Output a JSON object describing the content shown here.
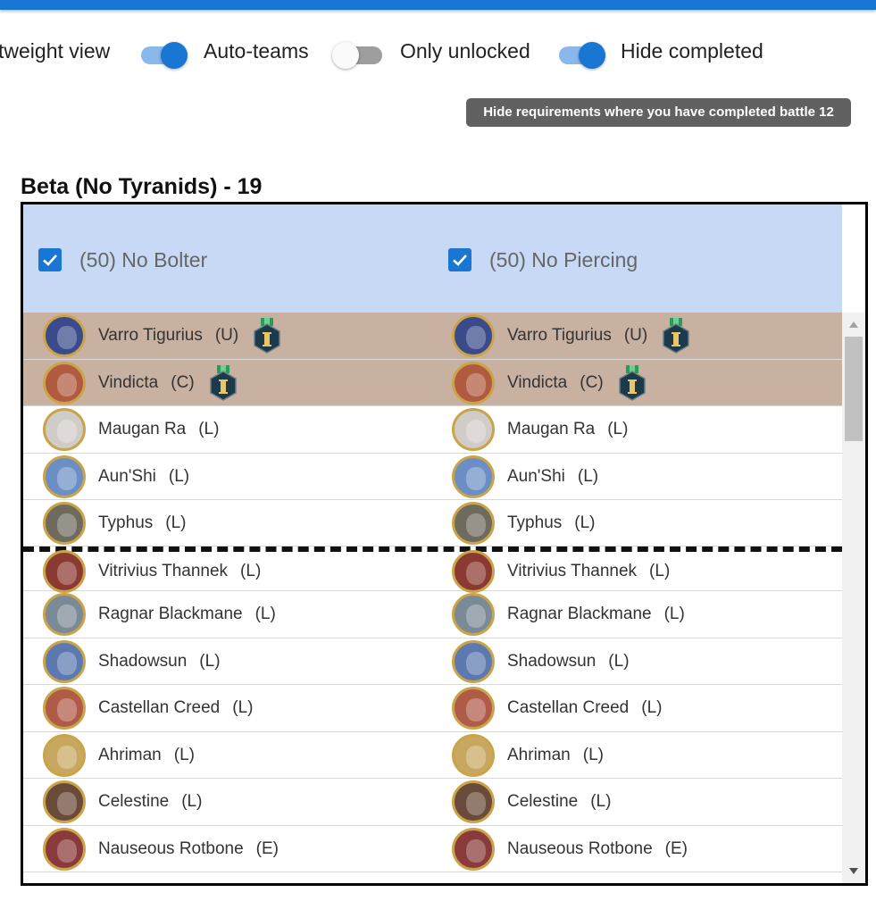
{
  "colors": {
    "accent": "#1976d2",
    "header_bg": "#c7d9f5",
    "highlight_row": "#c9b1a2",
    "tooltip_bg": "#616161"
  },
  "controls": {
    "lightweight_label": "tweight view",
    "auto_teams_label": "Auto-teams",
    "only_unlocked_label": "Only unlocked",
    "hide_completed_label": "Hide completed",
    "auto_teams_on": true,
    "only_unlocked_on": false,
    "hide_completed_on": true
  },
  "tooltip": {
    "text": "Hide requirements where you have completed battle 12"
  },
  "section": {
    "title": "Beta (No Tyranids) - 19"
  },
  "table": {
    "columns": [
      {
        "label": "(50) No Bolter",
        "checked": true
      },
      {
        "label": "(50) No Piercing",
        "checked": true
      }
    ],
    "rows": [
      {
        "name": "Varro Tigurius",
        "rarity": "(U)",
        "highlight": true,
        "medal": "medal-icon",
        "avatar": "#3a4a8a",
        "height": 53
      },
      {
        "name": "Vindicta",
        "rarity": "(C)",
        "highlight": true,
        "medal": "medal-icon",
        "avatar": "#b05a40",
        "height": 52
      },
      {
        "name": "Maugan Ra",
        "rarity": "(L)",
        "highlight": false,
        "avatar": "#d0ccc8",
        "height": 53
      },
      {
        "name": "Aun'Shi",
        "rarity": "(L)",
        "highlight": false,
        "avatar": "#6b8fc4",
        "height": 52
      },
      {
        "name": "Typhus",
        "rarity": "(L)",
        "highlight": false,
        "avatar": "#6e6a5e",
        "height": 52
      }
    ],
    "rows_after_separator": [
      {
        "name": "Vitrivius Thannek",
        "rarity": "(L)",
        "avatar": "#8a3a30",
        "height": 44
      },
      {
        "name": "Ragnar Blackmane",
        "rarity": "(L)",
        "avatar": "#7a8a96",
        "height": 53
      },
      {
        "name": "Shadowsun",
        "rarity": "(L)",
        "avatar": "#5d7ab0",
        "height": 52
      },
      {
        "name": "Castellan Creed",
        "rarity": "(L)",
        "avatar": "#b05a48",
        "height": 53
      },
      {
        "name": "Ahriman",
        "rarity": "(L)",
        "avatar": "#c8a860",
        "height": 52
      },
      {
        "name": "Celestine",
        "rarity": "(L)",
        "avatar": "#6a4a38",
        "height": 53
      },
      {
        "name": "Nauseous Rotbone",
        "rarity": "(E)",
        "avatar": "#8a3a3a",
        "height": 52
      }
    ]
  }
}
